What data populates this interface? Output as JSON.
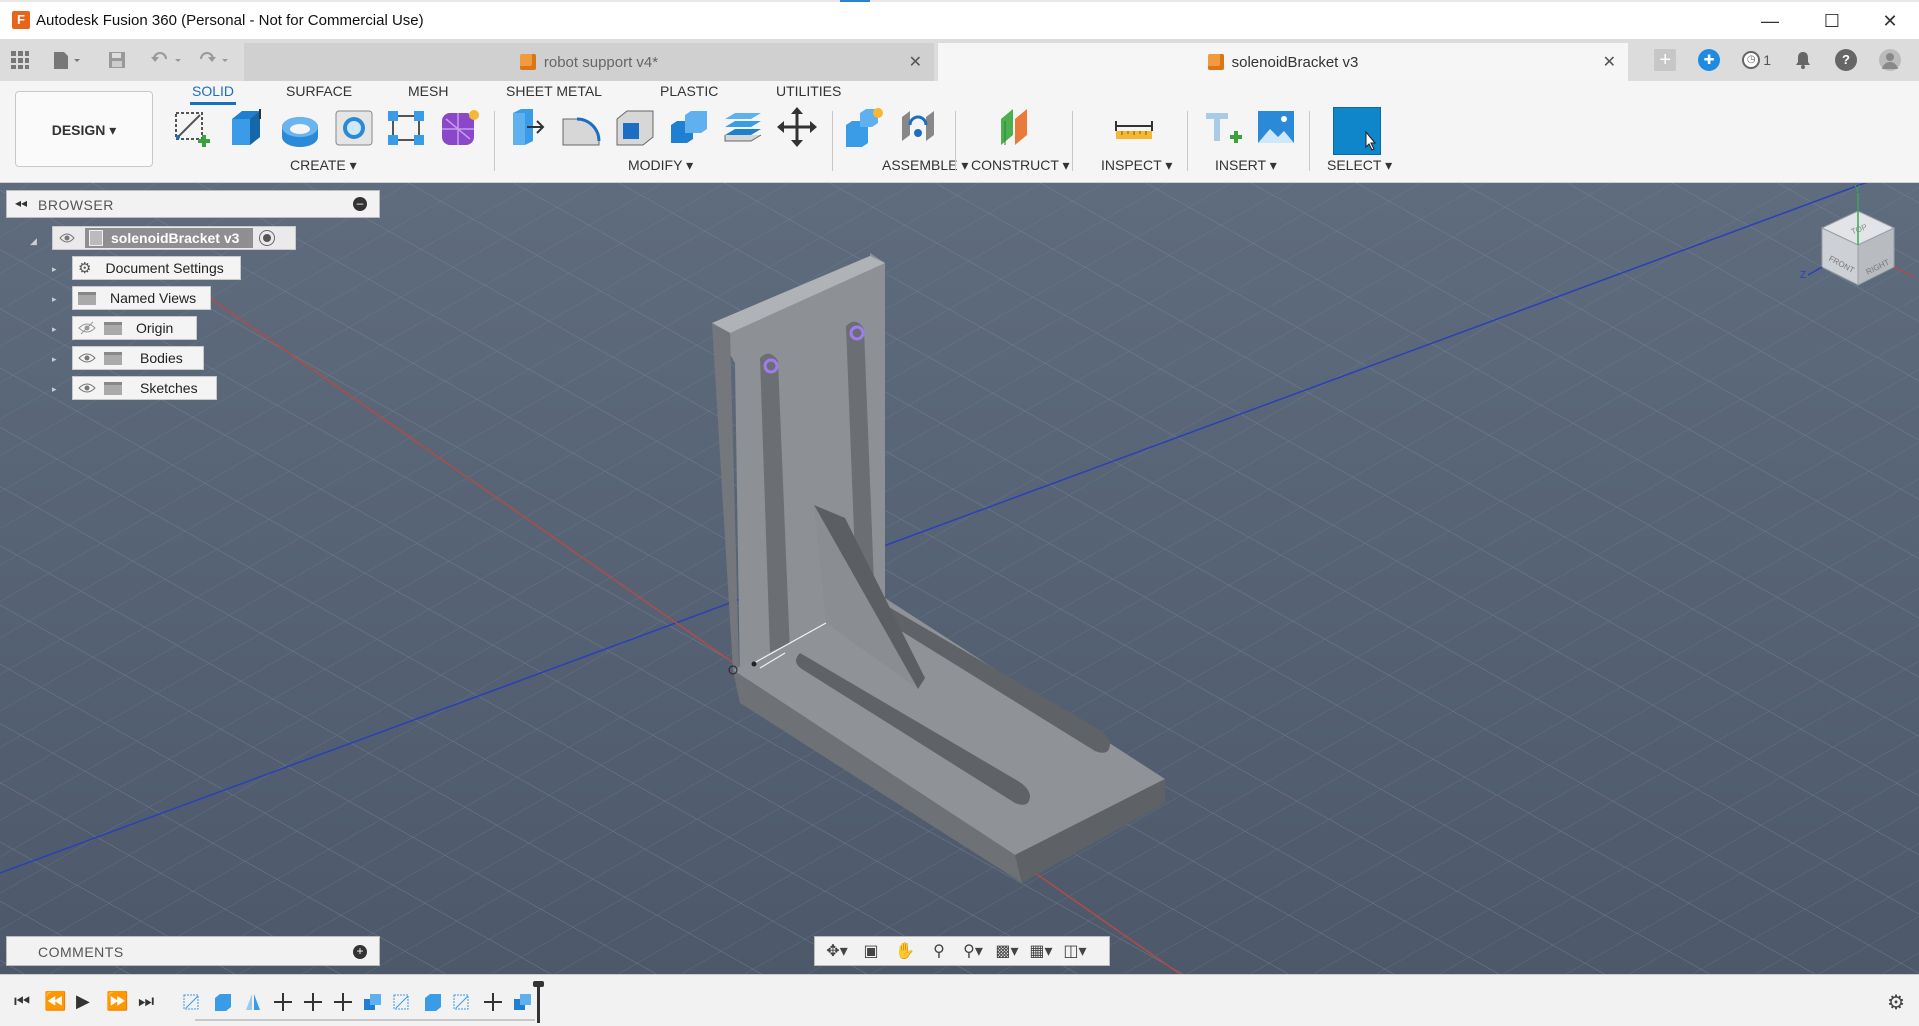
{
  "window": {
    "title": "Autodesk Fusion 360 (Personal - Not for Commercial Use)",
    "logo": "F",
    "controls": [
      "minimize-icon",
      "maximize-icon",
      "close-icon"
    ]
  },
  "tabs": [
    {
      "label": "robot support v4*",
      "active": false
    },
    {
      "label": "solenoidBracket v3",
      "active": true
    }
  ],
  "top_right": {
    "job_count": "1",
    "icons": [
      "new-tab-icon",
      "extensions-icon",
      "job-status-icon",
      "notifications-icon",
      "help-icon",
      "user-avatar-icon"
    ]
  },
  "workspace": {
    "label": "DESIGN ▾"
  },
  "ribbon_tabs": [
    "SOLID",
    "SURFACE",
    "MESH",
    "SHEET METAL",
    "PLASTIC",
    "UTILITIES"
  ],
  "ribbon_active": "SOLID",
  "groups": {
    "create": "CREATE ▾",
    "modify": "MODIFY ▾",
    "assemble": "ASSEMBLE ▾",
    "construct": "CONSTRUCT ▾",
    "inspect": "INSPECT ▾",
    "insert": "INSERT ▾",
    "select": "SELECT ▾"
  },
  "browser": {
    "title": "BROWSER",
    "root": "solenoidBracket v3",
    "items": [
      "Document Settings",
      "Named Views",
      "Origin",
      "Bodies",
      "Sketches"
    ]
  },
  "comments": {
    "title": "COMMENTS"
  },
  "viewcube": {
    "top": "TOP",
    "front": "FRONT",
    "right": "RIGHT",
    "axis_y": "Y",
    "axis_z": "Z"
  },
  "colors": {
    "accent": "#1a6ec4",
    "viewport_bg": "#56626f",
    "model": "#8f9397",
    "select_blue": "#0e86c9",
    "logo_orange": "#e8641b"
  }
}
